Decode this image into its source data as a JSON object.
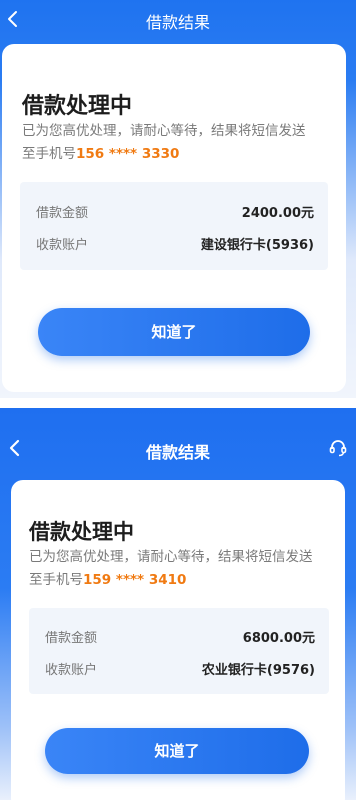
{
  "screen1": {
    "header": {
      "title": "借款结果"
    },
    "card": {
      "title": "借款处理中",
      "desc_line1": "已为您高优处理，请耐心等待，结果将短信发送",
      "desc_line2_prefix": "至手机号",
      "phone": "156 **** 3330",
      "amount_label": "借款金额",
      "amount_value": "2400.00元",
      "account_label": "收款账户",
      "account_value": "建设银行卡(5936)",
      "button_label": "知道了"
    }
  },
  "screen2": {
    "header": {
      "title": "借款结果"
    },
    "card": {
      "title": "借款处理中",
      "desc_line1": "已为您高优处理，请耐心等待，结果将短信发送",
      "desc_line2_prefix": "至手机号",
      "phone": "159 **** 3410",
      "amount_label": "借款金额",
      "amount_value": "6800.00元",
      "account_label": "收款账户",
      "account_value": "农业银行卡(9576)",
      "button_label": "知道了"
    }
  }
}
